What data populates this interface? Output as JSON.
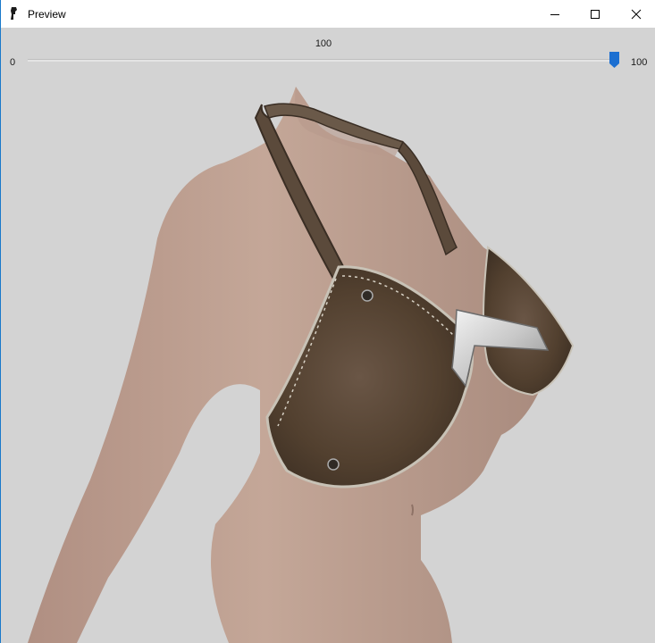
{
  "window": {
    "title": "Preview"
  },
  "icons": {
    "app": "figure-icon",
    "minimize": "minimize-icon",
    "maximize": "maximize-icon",
    "close": "close-icon"
  },
  "slider": {
    "value_label": "100",
    "min_label": "0",
    "max_label": "100",
    "value": 100,
    "min": 0,
    "max": 100
  },
  "colors": {
    "accent": "#1c6fd1",
    "background": "#d3d3d3",
    "window_border": "#1979ca"
  }
}
